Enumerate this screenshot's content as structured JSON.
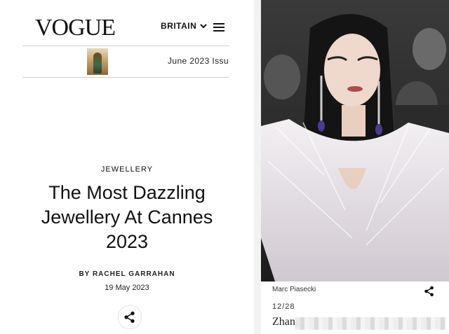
{
  "header": {
    "logo": "VOGUE",
    "region": "BRITAIN",
    "region_icon": "chevron-down-icon",
    "menu_icon": "hamburger-menu-icon"
  },
  "issue_bar": {
    "text": "June 2023 Issu",
    "cover_alt": "magazine-cover-thumbnail"
  },
  "article": {
    "category": "JEWELLERY",
    "title": "The Most Dazzling Jewellery At Cannes 2023",
    "byline_prefix": "BY",
    "author": "RACHEL GARRAHAN",
    "date": "19 May 2023",
    "share_icon": "share-icon"
  },
  "right_panel": {
    "photo_alt": "red-carpet-photo",
    "photo_credit": "Marc Piasecki",
    "date": "12/28",
    "title": "Zhang"
  },
  "colors": {
    "text": "#111111",
    "divider": "#f2f2f2",
    "rule": "#cfcfcf"
  }
}
